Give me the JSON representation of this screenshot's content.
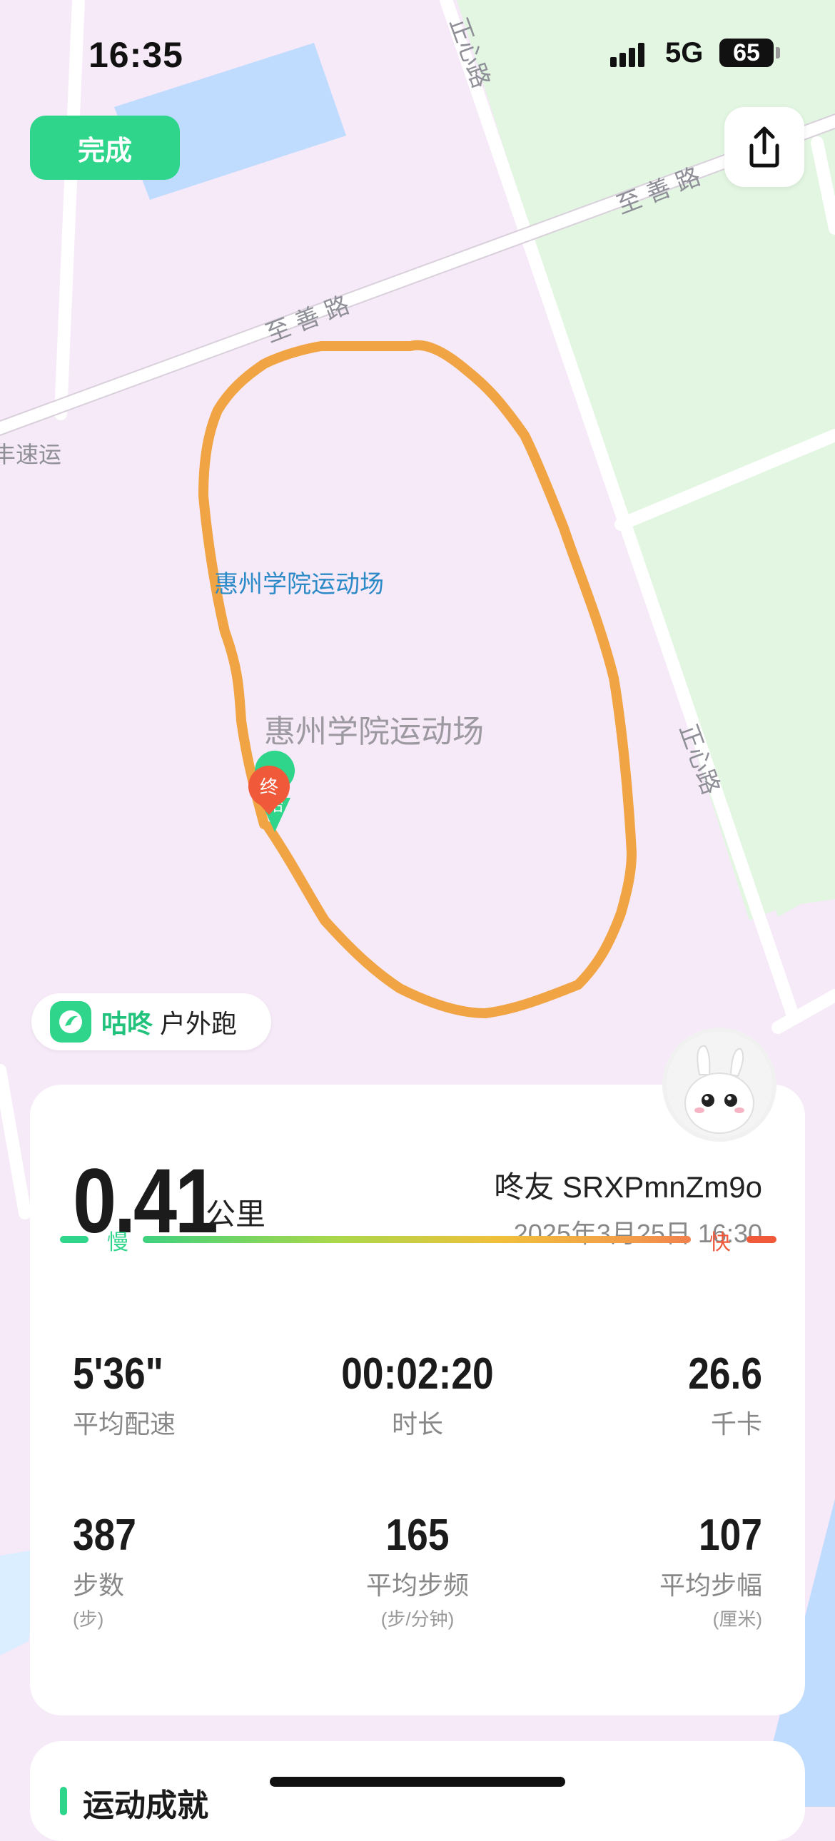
{
  "status_bar": {
    "time": "16:35",
    "network": "5G",
    "battery": "65"
  },
  "top": {
    "done_label": "完成",
    "share_icon": "share-icon"
  },
  "map": {
    "road_labels": [
      "正心路",
      "至善路",
      "至善路",
      "正心路",
      "丰速运"
    ],
    "poi_labels": [
      "惠州学院运动场",
      "惠州学院运动场"
    ],
    "end_marker": "终",
    "start_marker": "始",
    "route_color": "#f0a443",
    "green_area_color": "#e2f6e2",
    "water_color": "#bfdcff"
  },
  "brand": {
    "name": "咕咚",
    "activity": "户外跑",
    "logo_icon": "codoon-logo-icon"
  },
  "summary": {
    "distance": "0.41",
    "distance_unit": "公里",
    "user": "咚友 SRXPmnZm9o",
    "datetime": "2025年3月25日 16:30",
    "pace_slow": "慢",
    "pace_fast": "快"
  },
  "stats": [
    {
      "value": "5'36\"",
      "label": "平均配速",
      "sub": ""
    },
    {
      "value": "00:02:20",
      "label": "时长",
      "sub": ""
    },
    {
      "value": "26.6",
      "label": "千卡",
      "sub": ""
    },
    {
      "value": "387",
      "label": "步数",
      "sub": "(步)"
    },
    {
      "value": "165",
      "label": "平均步频",
      "sub": "(步/分钟)"
    },
    {
      "value": "107",
      "label": "平均步幅",
      "sub": "(厘米)"
    }
  ],
  "achievement": {
    "title": "运动成就"
  },
  "colors": {
    "accent": "#2fd58a",
    "fast": "#f0593a",
    "background": "#f6e9f8"
  }
}
